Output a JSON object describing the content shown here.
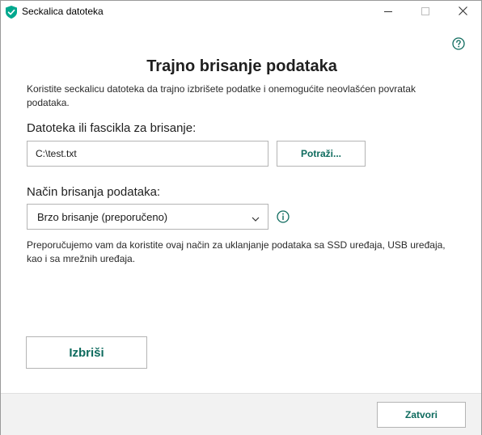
{
  "window": {
    "title": "Seckalica datoteka",
    "icon": "kaspersky-shield-icon"
  },
  "colors": {
    "accent": "#0e6b5e",
    "brand_green": "#00a88e",
    "footer_bg": "#f2f2f2"
  },
  "main": {
    "heading": "Trajno brisanje podataka",
    "description": "Koristite seckalicu datoteka da trajno izbrišete podatke i onemogućite neovlašćen povratak podataka.",
    "file_label": "Datoteka ili fascikla za brisanje:",
    "file_value": "C:\\test.txt",
    "browse_label": "Potraži...",
    "method_label": "Način brisanja podataka:",
    "method_selected": "Brzo brisanje (preporučeno)",
    "method_note": "Preporučujemo vam da koristite ovaj način za uklanjanje podataka sa SSD uređaja, USB uređaja, kao i sa mrežnih uređaja.",
    "delete_label": "Izbriši"
  },
  "footer": {
    "close_label": "Zatvori"
  }
}
